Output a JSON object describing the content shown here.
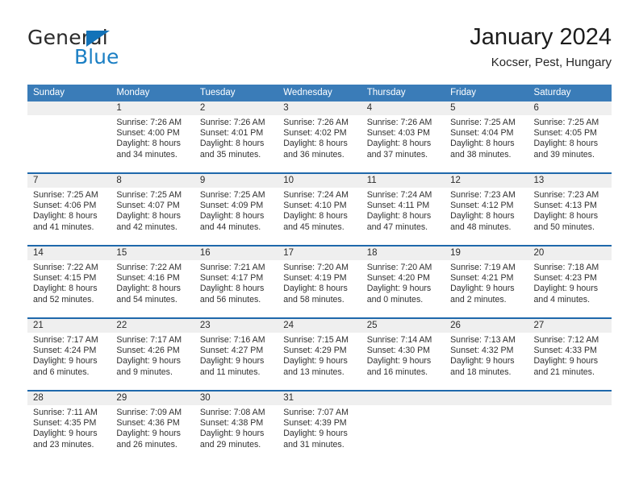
{
  "brand": {
    "name_part1": "General",
    "name_part2": "Blue",
    "triangle_color": "#1272b8"
  },
  "header": {
    "title": "January 2024",
    "subtitle": "Kocser, Pest, Hungary"
  },
  "theme": {
    "header_bar": "#3a7cb8",
    "week_divider": "#1f68ab",
    "day_number_band": "#efefef",
    "brand_blue": "#1b7fc4"
  },
  "weekdays": [
    "Sunday",
    "Monday",
    "Tuesday",
    "Wednesday",
    "Thursday",
    "Friday",
    "Saturday"
  ],
  "labels": {
    "sunrise_prefix": "Sunrise:",
    "sunset_prefix": "Sunset:",
    "daylight_prefix": "Daylight:"
  },
  "weeks": [
    [
      {
        "day": "",
        "empty": true
      },
      {
        "day": "1",
        "sunrise": "Sunrise: 7:26 AM",
        "sunset": "Sunset: 4:00 PM",
        "daylight_line1": "Daylight: 8 hours",
        "daylight_line2": "and 34 minutes."
      },
      {
        "day": "2",
        "sunrise": "Sunrise: 7:26 AM",
        "sunset": "Sunset: 4:01 PM",
        "daylight_line1": "Daylight: 8 hours",
        "daylight_line2": "and 35 minutes."
      },
      {
        "day": "3",
        "sunrise": "Sunrise: 7:26 AM",
        "sunset": "Sunset: 4:02 PM",
        "daylight_line1": "Daylight: 8 hours",
        "daylight_line2": "and 36 minutes."
      },
      {
        "day": "4",
        "sunrise": "Sunrise: 7:26 AM",
        "sunset": "Sunset: 4:03 PM",
        "daylight_line1": "Daylight: 8 hours",
        "daylight_line2": "and 37 minutes."
      },
      {
        "day": "5",
        "sunrise": "Sunrise: 7:25 AM",
        "sunset": "Sunset: 4:04 PM",
        "daylight_line1": "Daylight: 8 hours",
        "daylight_line2": "and 38 minutes."
      },
      {
        "day": "6",
        "sunrise": "Sunrise: 7:25 AM",
        "sunset": "Sunset: 4:05 PM",
        "daylight_line1": "Daylight: 8 hours",
        "daylight_line2": "and 39 minutes."
      }
    ],
    [
      {
        "day": "7",
        "sunrise": "Sunrise: 7:25 AM",
        "sunset": "Sunset: 4:06 PM",
        "daylight_line1": "Daylight: 8 hours",
        "daylight_line2": "and 41 minutes."
      },
      {
        "day": "8",
        "sunrise": "Sunrise: 7:25 AM",
        "sunset": "Sunset: 4:07 PM",
        "daylight_line1": "Daylight: 8 hours",
        "daylight_line2": "and 42 minutes."
      },
      {
        "day": "9",
        "sunrise": "Sunrise: 7:25 AM",
        "sunset": "Sunset: 4:09 PM",
        "daylight_line1": "Daylight: 8 hours",
        "daylight_line2": "and 44 minutes."
      },
      {
        "day": "10",
        "sunrise": "Sunrise: 7:24 AM",
        "sunset": "Sunset: 4:10 PM",
        "daylight_line1": "Daylight: 8 hours",
        "daylight_line2": "and 45 minutes."
      },
      {
        "day": "11",
        "sunrise": "Sunrise: 7:24 AM",
        "sunset": "Sunset: 4:11 PM",
        "daylight_line1": "Daylight: 8 hours",
        "daylight_line2": "and 47 minutes."
      },
      {
        "day": "12",
        "sunrise": "Sunrise: 7:23 AM",
        "sunset": "Sunset: 4:12 PM",
        "daylight_line1": "Daylight: 8 hours",
        "daylight_line2": "and 48 minutes."
      },
      {
        "day": "13",
        "sunrise": "Sunrise: 7:23 AM",
        "sunset": "Sunset: 4:13 PM",
        "daylight_line1": "Daylight: 8 hours",
        "daylight_line2": "and 50 minutes."
      }
    ],
    [
      {
        "day": "14",
        "sunrise": "Sunrise: 7:22 AM",
        "sunset": "Sunset: 4:15 PM",
        "daylight_line1": "Daylight: 8 hours",
        "daylight_line2": "and 52 minutes."
      },
      {
        "day": "15",
        "sunrise": "Sunrise: 7:22 AM",
        "sunset": "Sunset: 4:16 PM",
        "daylight_line1": "Daylight: 8 hours",
        "daylight_line2": "and 54 minutes."
      },
      {
        "day": "16",
        "sunrise": "Sunrise: 7:21 AM",
        "sunset": "Sunset: 4:17 PM",
        "daylight_line1": "Daylight: 8 hours",
        "daylight_line2": "and 56 minutes."
      },
      {
        "day": "17",
        "sunrise": "Sunrise: 7:20 AM",
        "sunset": "Sunset: 4:19 PM",
        "daylight_line1": "Daylight: 8 hours",
        "daylight_line2": "and 58 minutes."
      },
      {
        "day": "18",
        "sunrise": "Sunrise: 7:20 AM",
        "sunset": "Sunset: 4:20 PM",
        "daylight_line1": "Daylight: 9 hours",
        "daylight_line2": "and 0 minutes."
      },
      {
        "day": "19",
        "sunrise": "Sunrise: 7:19 AM",
        "sunset": "Sunset: 4:21 PM",
        "daylight_line1": "Daylight: 9 hours",
        "daylight_line2": "and 2 minutes."
      },
      {
        "day": "20",
        "sunrise": "Sunrise: 7:18 AM",
        "sunset": "Sunset: 4:23 PM",
        "daylight_line1": "Daylight: 9 hours",
        "daylight_line2": "and 4 minutes."
      }
    ],
    [
      {
        "day": "21",
        "sunrise": "Sunrise: 7:17 AM",
        "sunset": "Sunset: 4:24 PM",
        "daylight_line1": "Daylight: 9 hours",
        "daylight_line2": "and 6 minutes."
      },
      {
        "day": "22",
        "sunrise": "Sunrise: 7:17 AM",
        "sunset": "Sunset: 4:26 PM",
        "daylight_line1": "Daylight: 9 hours",
        "daylight_line2": "and 9 minutes."
      },
      {
        "day": "23",
        "sunrise": "Sunrise: 7:16 AM",
        "sunset": "Sunset: 4:27 PM",
        "daylight_line1": "Daylight: 9 hours",
        "daylight_line2": "and 11 minutes."
      },
      {
        "day": "24",
        "sunrise": "Sunrise: 7:15 AM",
        "sunset": "Sunset: 4:29 PM",
        "daylight_line1": "Daylight: 9 hours",
        "daylight_line2": "and 13 minutes."
      },
      {
        "day": "25",
        "sunrise": "Sunrise: 7:14 AM",
        "sunset": "Sunset: 4:30 PM",
        "daylight_line1": "Daylight: 9 hours",
        "daylight_line2": "and 16 minutes."
      },
      {
        "day": "26",
        "sunrise": "Sunrise: 7:13 AM",
        "sunset": "Sunset: 4:32 PM",
        "daylight_line1": "Daylight: 9 hours",
        "daylight_line2": "and 18 minutes."
      },
      {
        "day": "27",
        "sunrise": "Sunrise: 7:12 AM",
        "sunset": "Sunset: 4:33 PM",
        "daylight_line1": "Daylight: 9 hours",
        "daylight_line2": "and 21 minutes."
      }
    ],
    [
      {
        "day": "28",
        "sunrise": "Sunrise: 7:11 AM",
        "sunset": "Sunset: 4:35 PM",
        "daylight_line1": "Daylight: 9 hours",
        "daylight_line2": "and 23 minutes."
      },
      {
        "day": "29",
        "sunrise": "Sunrise: 7:09 AM",
        "sunset": "Sunset: 4:36 PM",
        "daylight_line1": "Daylight: 9 hours",
        "daylight_line2": "and 26 minutes."
      },
      {
        "day": "30",
        "sunrise": "Sunrise: 7:08 AM",
        "sunset": "Sunset: 4:38 PM",
        "daylight_line1": "Daylight: 9 hours",
        "daylight_line2": "and 29 minutes."
      },
      {
        "day": "31",
        "sunrise": "Sunrise: 7:07 AM",
        "sunset": "Sunset: 4:39 PM",
        "daylight_line1": "Daylight: 9 hours",
        "daylight_line2": "and 31 minutes."
      },
      {
        "day": "",
        "empty": true
      },
      {
        "day": "",
        "empty": true
      },
      {
        "day": "",
        "empty": true
      }
    ]
  ]
}
